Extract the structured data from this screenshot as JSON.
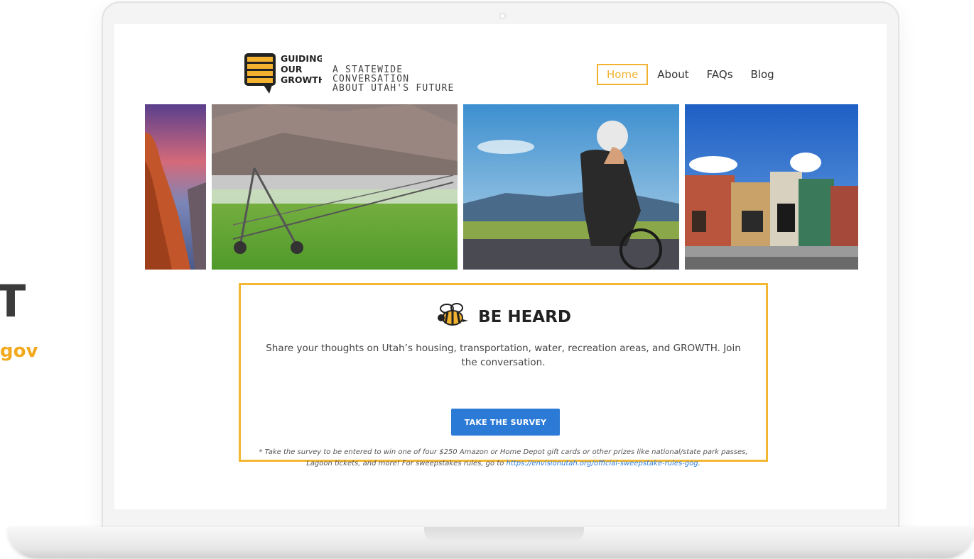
{
  "side": {
    "big_text": "T",
    "gov_text": "gov"
  },
  "header": {
    "logo_lines": [
      "GUIDING",
      "OUR",
      "GROWTH"
    ],
    "tagline_line1": "A STATEWIDE CONVERSATION",
    "tagline_line2": "ABOUT UTAH'S FUTURE"
  },
  "nav": {
    "items": [
      {
        "label": "Home",
        "active": true
      },
      {
        "label": "About"
      },
      {
        "label": "FAQs"
      },
      {
        "label": "Blog"
      }
    ]
  },
  "photos": [
    {
      "subject": "red rock canyon at sunset"
    },
    {
      "subject": "center pivot irrigation over green field"
    },
    {
      "subject": "cyclist on road"
    },
    {
      "subject": "small-town main street buildings"
    }
  ],
  "card": {
    "title": "BE HEARD",
    "body": "Share your thoughts on Utah’s housing, transportation, water, recreation areas, and GROWTH. Join the conversation.",
    "button_label": "TAKE THE SURVEY",
    "note_prefix": "* Take the survey to be entered to win one of four $250 Amazon or Home Depot gift cards or other prizes like national/state park passes, Lagoon tickets, and more! For sweepstakes rules, go to ",
    "note_link": "https://envisionutah.org/official-sweepstake-rules-gog",
    "note_suffix": "."
  },
  "colors": {
    "accent": "#f2b733",
    "button": "#2a7ad6",
    "logo_yellow": "#f2b230",
    "logo_dark": "#222222"
  }
}
